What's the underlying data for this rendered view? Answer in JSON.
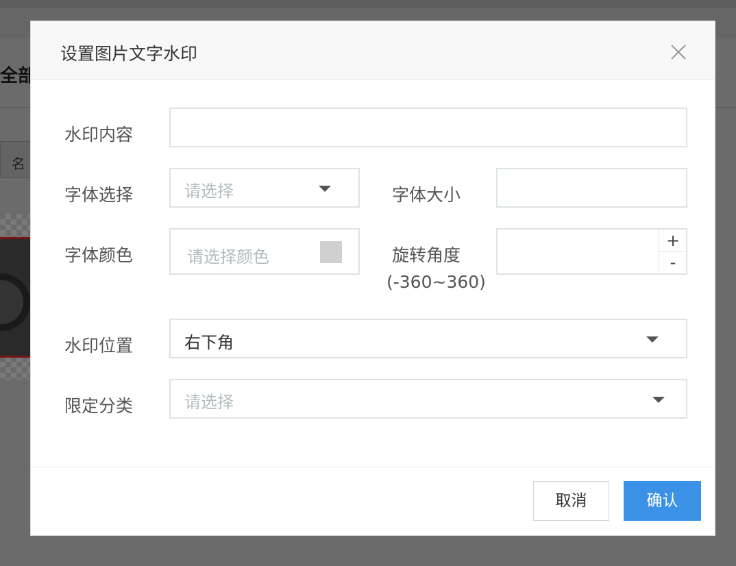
{
  "background": {
    "page_title": "全部",
    "tab_label": "名"
  },
  "dialog": {
    "title": "设置图片文字水印",
    "close_icon": "close-icon",
    "fields": {
      "watermark_content": {
        "label": "水印内容",
        "value": ""
      },
      "font_select": {
        "label": "字体选择",
        "placeholder": "请选择"
      },
      "font_size": {
        "label": "字体大小",
        "value": ""
      },
      "font_color": {
        "label": "字体颜色",
        "placeholder": "请选择颜色",
        "swatch_color": "#d0d0d0"
      },
      "rotation": {
        "label": "旋转角度",
        "label_range": "(-360~360)",
        "value": "",
        "plus": "+",
        "minus": "-"
      },
      "position": {
        "label": "水印位置",
        "value": "右下角"
      },
      "category": {
        "label": "限定分类",
        "placeholder": "请选择"
      }
    },
    "buttons": {
      "cancel": "取消",
      "confirm": "确认"
    },
    "colors": {
      "primary": "#3a91e6",
      "border": "#dde3e6",
      "placeholder": "#b4bcc0"
    }
  }
}
